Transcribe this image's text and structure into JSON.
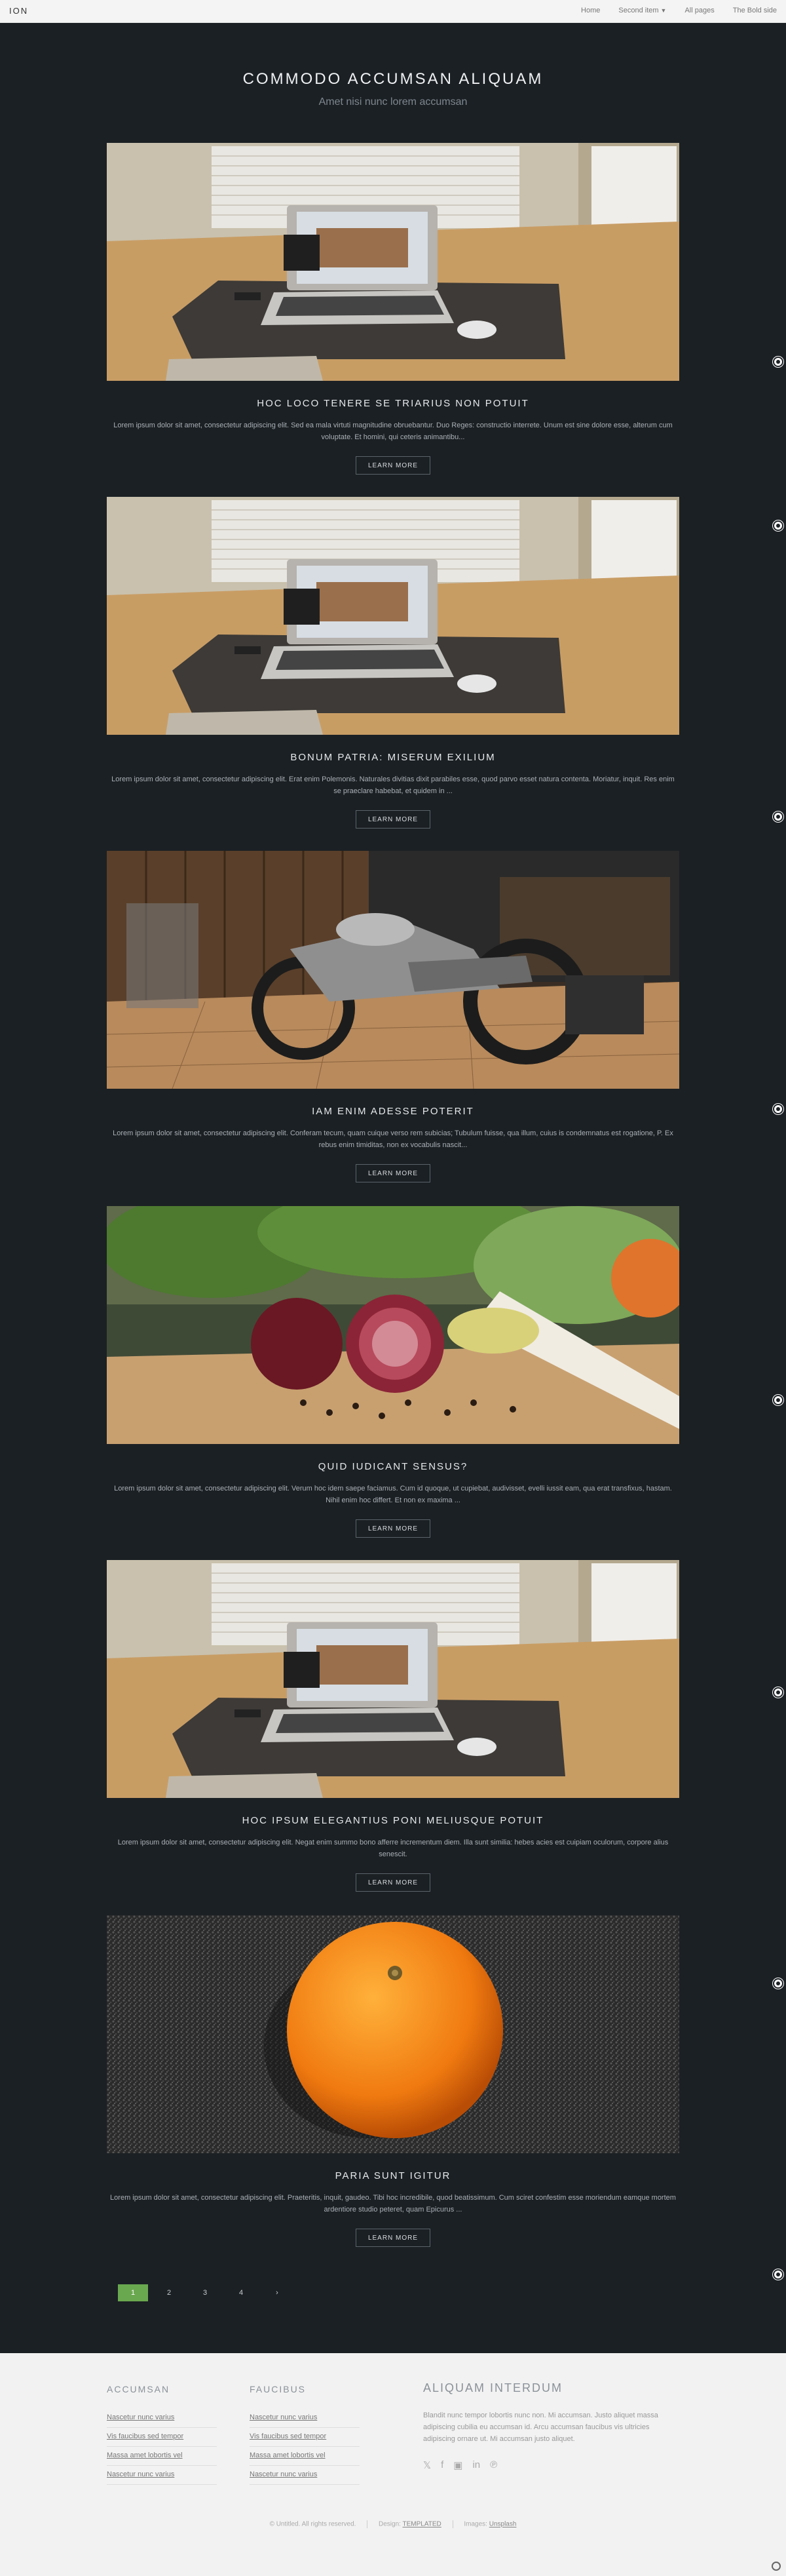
{
  "nav": {
    "brand": "ION",
    "items": [
      {
        "label": "Home"
      },
      {
        "label": "Second item"
      },
      {
        "label": "All pages"
      },
      {
        "label": "The Bold side"
      }
    ]
  },
  "hero": {
    "title": "COMMODO ACCUMSAN ALIQUAM",
    "subtitle": "Amet nisi nunc lorem accumsan"
  },
  "posts": [
    {
      "title": "HOC LOCO TENERE SE TRIARIUS NON POTUIT",
      "text": "Lorem ipsum dolor sit amet, consectetur adipiscing elit. Sed ea mala virtuti magnitudine obruebantur. Duo Reges: constructio interrete. Unum est sine dolore esse, alterum cum voluptate. Et homini, qui ceteris animantibu...",
      "button": "LEARN MORE",
      "image": "desk-laptop"
    },
    {
      "title": "BONUM PATRIA: MISERUM EXILIUM",
      "text": "Lorem ipsum dolor sit amet, consectetur adipiscing elit. Erat enim Polemonis. Naturales divitias dixit parabiles esse, quod parvo esset natura contenta. Moriatur, inquit. Res enim se praeclare habebat, et quidem in ...",
      "button": "LEARN MORE",
      "image": "desk-laptop"
    },
    {
      "title": "IAM ENIM ADESSE POTERIT",
      "text": "Lorem ipsum dolor sit amet, consectetur adipiscing elit. Conferam tecum, quam cuique verso rem subicias; Tubulum fuisse, qua illum, cuius is condemnatus est rogatione, P. Ex rebus enim timiditas, non ex vocabulis nascit...",
      "button": "LEARN MORE",
      "image": "motorcycle"
    },
    {
      "title": "QUID IUDICANT SENSUS?",
      "text": "Lorem ipsum dolor sit amet, consectetur adipiscing elit. Verum hoc idem saepe faciamus. Cum id quoque, ut cupiebat, audivisset, evelli iussit eam, qua erat transfixus, hastam. Nihil enim hoc differt. Et non ex maxima ...",
      "button": "LEARN MORE",
      "image": "vegetables"
    },
    {
      "title": "HOC IPSUM ELEGANTIUS PONI MELIUSQUE POTUIT",
      "text": "Lorem ipsum dolor sit amet, consectetur adipiscing elit. Negat enim summo bono afferre incrementum diem. Illa sunt similia: hebes acies est cuipiam oculorum, corpore alius senescit.",
      "button": "LEARN MORE",
      "image": "desk-laptop"
    },
    {
      "title": "PARIA SUNT IGITUR",
      "text": "Lorem ipsum dolor sit amet, consectetur adipiscing elit. Praeteritis, inquit, gaudeo. Tibi hoc incredibile, quod beatissimum. Cum sciret confestim esse moriendum eamque mortem ardentiore studio peteret, quam Epicurus ...",
      "button": "LEARN MORE",
      "image": "orange"
    }
  ],
  "pagination": {
    "pages": [
      "1",
      "2",
      "3",
      "4"
    ],
    "next": "›",
    "active": "1"
  },
  "footer": {
    "col1": {
      "heading": "ACCUMSAN",
      "links": [
        "Nascetur nunc varius",
        "Vis faucibus sed tempor",
        "Massa amet lobortis vel",
        "Nascetur nunc varius"
      ]
    },
    "col2": {
      "heading": "FAUCIBUS",
      "links": [
        "Nascetur nunc varius",
        "Vis faucibus sed tempor",
        "Massa amet lobortis vel",
        "Nascetur nunc varius"
      ]
    },
    "about": {
      "heading": "ALIQUAM INTERDUM",
      "text": "Blandit nunc tempor lobortis nunc non. Mi accumsan. Justo aliquet massa adipiscing cubilia eu accumsan id. Arcu accumsan faucibus vis ultricies adipiscing ornare ut. Mi accumsan justo aliquet."
    },
    "socials": [
      "twitter-icon",
      "facebook-icon",
      "instagram-icon",
      "linkedin-icon",
      "pinterest-icon"
    ],
    "credits": {
      "copyright": "© Untitled. All rights reserved.",
      "design_label": "Design:",
      "design_link": "TEMPLATED",
      "images_label": "Images:",
      "images_link": "Unsplash"
    }
  }
}
